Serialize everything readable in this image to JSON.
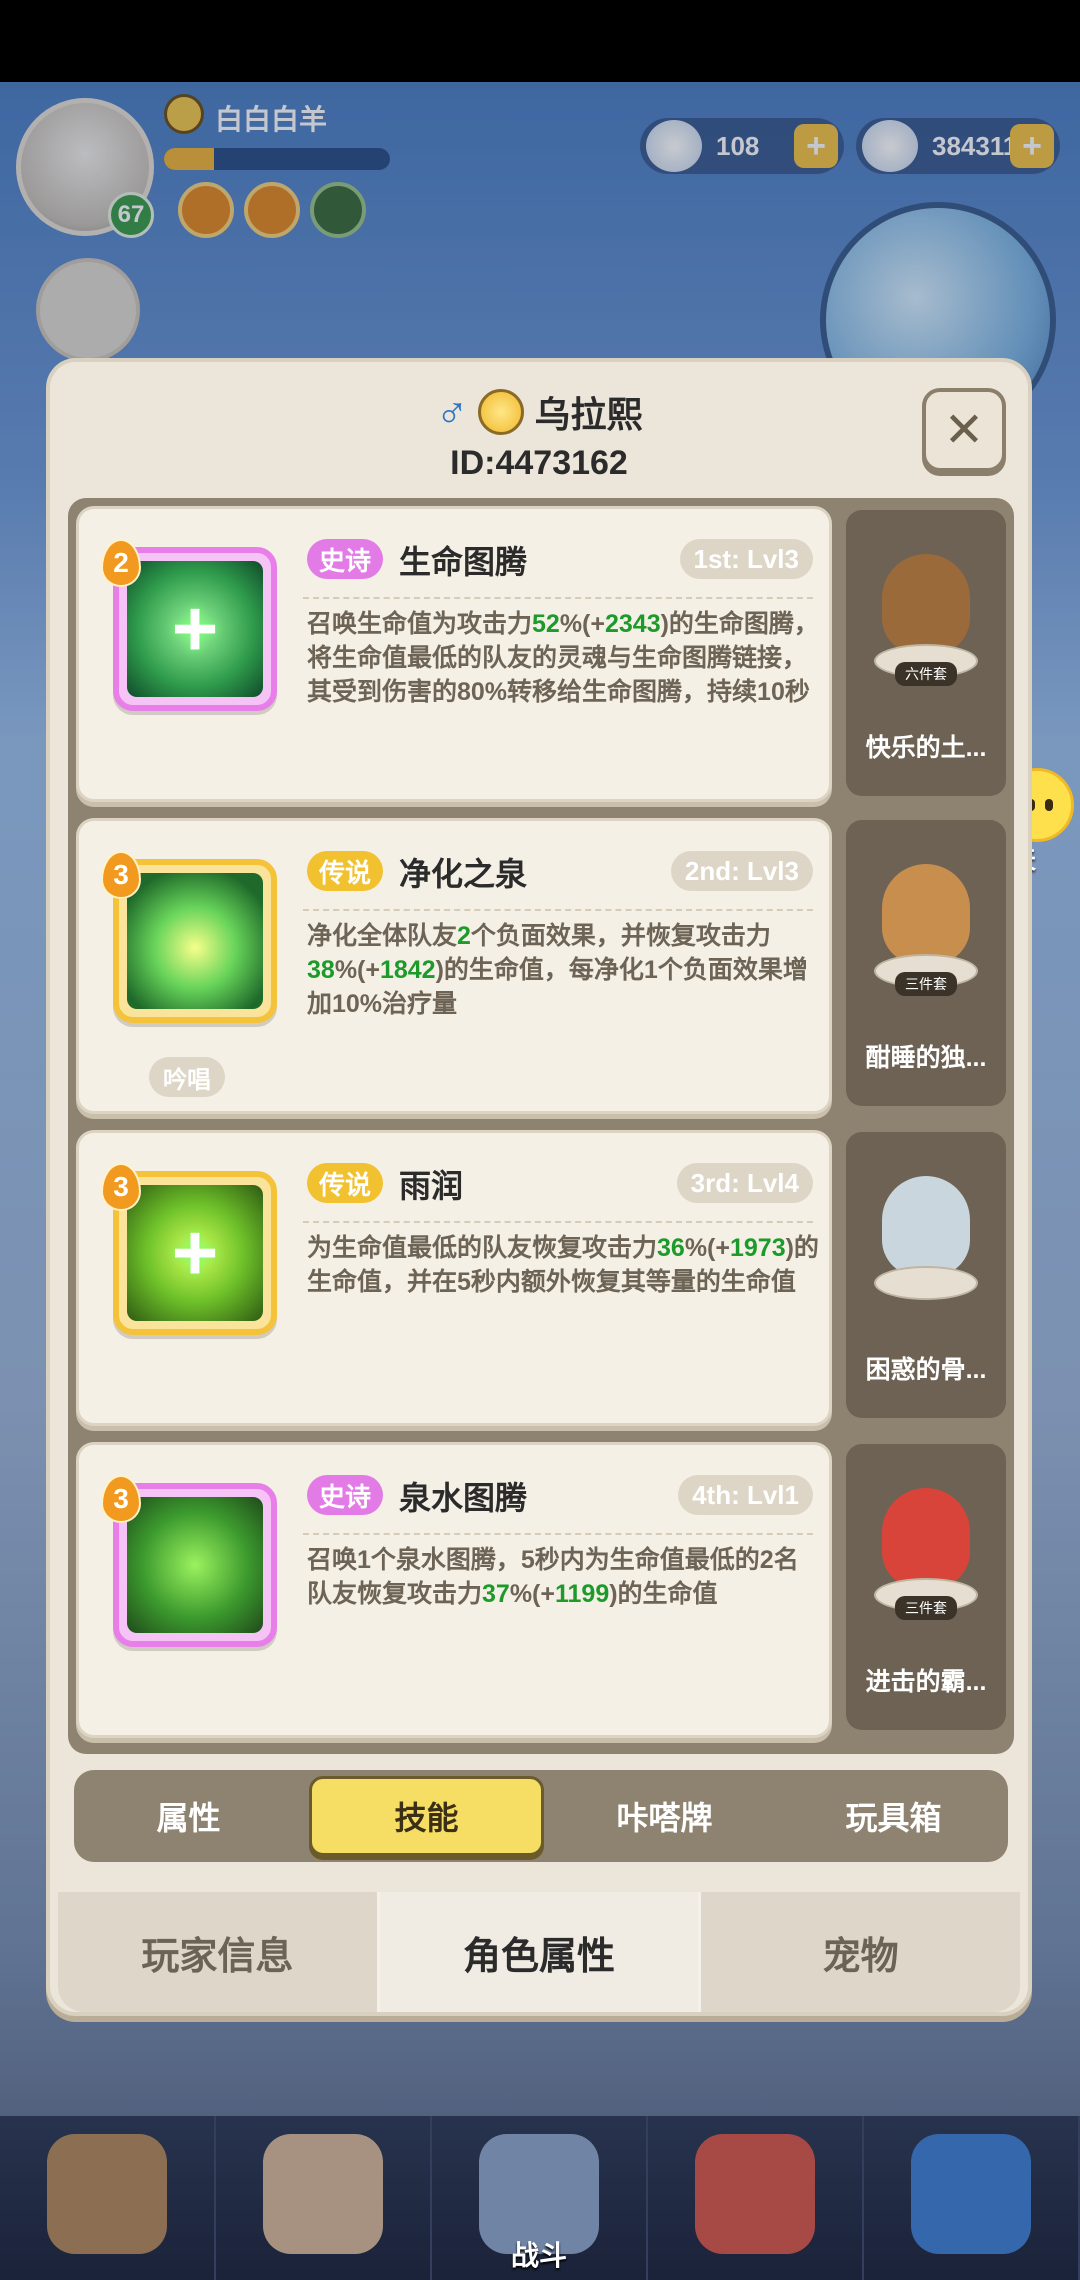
{
  "hud": {
    "player_name": "白白白羊",
    "player_level": "67",
    "xp_fraction": 0.22,
    "resource_1": "108",
    "resource_2": "384311"
  },
  "chat": {
    "label": "聊天"
  },
  "bottom_nav": {
    "battle_label": "战斗"
  },
  "modal": {
    "gender_symbol": "♂",
    "name": "乌拉熙",
    "id_text": "ID:4473162",
    "close_symbol": "✕"
  },
  "skills": [
    {
      "badge": "2",
      "rarity": "史诗",
      "name": "生命图腾",
      "level": "1st: Lvl3",
      "desc_parts": [
        "召唤生命值为攻击力",
        "52",
        "%(+",
        "2343",
        ")的生命图腾，将生命值最低的队友的灵魂与生命图腾链接，其受到伤害的80%转移给生命图腾，持续10秒"
      ]
    },
    {
      "badge": "3",
      "rarity": "传说",
      "name": "净化之泉",
      "level": "2nd: Lvl3",
      "chant": "吟唱",
      "desc_parts": [
        "净化全体队友",
        "2",
        "个负面效果，并恢复攻击力",
        "38",
        "%(+",
        "1842",
        ")的生命值，每净化1个负面效果增加10%治疗量"
      ]
    },
    {
      "badge": "3",
      "rarity": "传说",
      "name": "雨润",
      "level": "3rd: Lvl4",
      "desc_parts": [
        "为生命值最低的队友恢复攻击力",
        "36",
        "%(+",
        "1973",
        ")的生命值，并在5秒内额外恢复其等量的生命值"
      ]
    },
    {
      "badge": "3",
      "rarity": "史诗",
      "name": "泉水图腾",
      "level": "4th: Lvl1",
      "desc_parts": [
        "召唤1个泉水图腾，5秒内为生命值最低的2名队友恢复攻击力",
        "37",
        "%(+",
        "1199",
        ")的生命值"
      ]
    }
  ],
  "pets": [
    {
      "name": "快乐的土...",
      "set": "六件套"
    },
    {
      "name": "酣睡的独...",
      "set": "三件套"
    },
    {
      "name": "困惑的骨..."
    },
    {
      "name": "进击的霸...",
      "set": "三件套"
    }
  ],
  "sub_tabs": [
    "属性",
    "技能",
    "咔嗒牌",
    "玩具箱"
  ],
  "main_tabs": [
    "玩家信息",
    "角色属性",
    "宠物"
  ],
  "colors": {
    "epic": "#e37be6",
    "legend": "#f1c12f",
    "highlight_green": "#1c9a2a",
    "active_tab": "#f6dd63"
  }
}
